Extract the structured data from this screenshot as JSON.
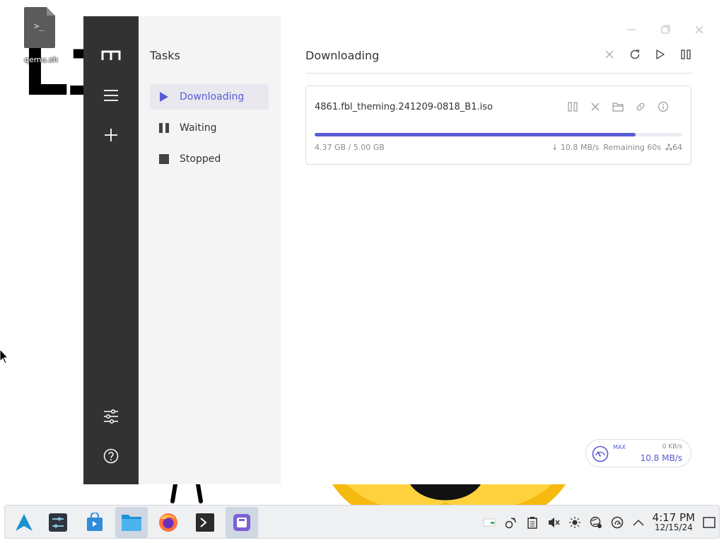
{
  "desktop": {
    "file_label": "qemu.sh",
    "file_glyph": ">_",
    "bg_letters": "Li"
  },
  "app": {
    "window_controls": [
      "minimize-icon",
      "maximize-icon",
      "close-icon"
    ],
    "rail": {
      "items": [
        "logo-icon",
        "menu-icon",
        "add-icon"
      ],
      "bottom": [
        "preferences-icon",
        "help-icon"
      ]
    },
    "subnav": {
      "title": "Tasks",
      "items": [
        {
          "label": "Downloading",
          "icon": "play-icon",
          "active": true
        },
        {
          "label": "Waiting",
          "icon": "pause-icon",
          "active": false
        },
        {
          "label": "Stopped",
          "icon": "stop-icon",
          "active": false
        }
      ]
    },
    "main": {
      "title": "Downloading",
      "toolbar": [
        "close-icon",
        "refresh-icon",
        "play-icon",
        "pause-icon"
      ],
      "task": {
        "name": "4861.fbl_theming.241209-0818_B1.iso",
        "actions": [
          "pause-icon",
          "close-icon",
          "folder-icon",
          "link-icon",
          "info-icon"
        ],
        "progress_fraction": 0.874,
        "size": "4.37 GB / 5.00 GB",
        "speed": "↓ 10.8 MB/s",
        "remaining": "Remaining 60s",
        "connections": "64"
      }
    },
    "speedometer": {
      "max_label": "MAX",
      "upload": "0 KB/s",
      "download": "10.8 MB/s"
    }
  },
  "taskbar": {
    "apps": [
      "arch-launcher-icon",
      "settings-app-icon",
      "discover-app-icon",
      "file-manager-icon",
      "firefox-icon",
      "terminal-icon",
      "motrix-icon"
    ],
    "active_app": "motrix-icon",
    "tray": [
      "battery-icon",
      "network-icon",
      "clipboard-icon",
      "volume-muted-icon",
      "brightness-icon",
      "vpn-icon",
      "updates-icon",
      "expand-icon"
    ],
    "time": "4:17 PM",
    "date": "12/15/24"
  },
  "colors": {
    "accent": "#5b5bd6",
    "rail": "#323232",
    "subnav": "#f4f4f5"
  }
}
